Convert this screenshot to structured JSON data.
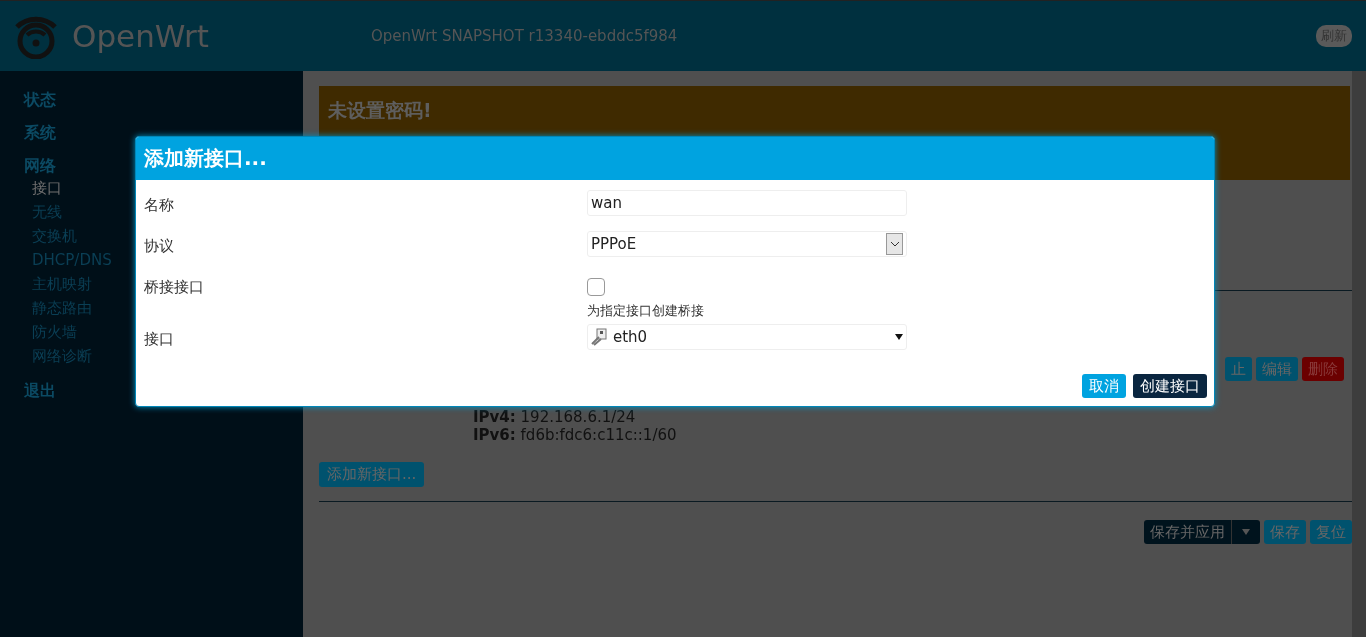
{
  "header": {
    "brand": "OpenWrt",
    "version": "OpenWrt SNAPSHOT r13340-ebddc5f984",
    "refresh_button": "刷新"
  },
  "sidebar": {
    "items": [
      {
        "label": "状态"
      },
      {
        "label": "系统"
      },
      {
        "label": "网络",
        "children": [
          {
            "label": "接口",
            "selected": true
          },
          {
            "label": "无线",
            "selected": false
          },
          {
            "label": "交换机",
            "selected": false
          },
          {
            "label": "DHCP/DNS",
            "selected": false
          },
          {
            "label": "主机映射",
            "selected": false
          },
          {
            "label": "静态路由",
            "selected": false
          },
          {
            "label": "防火墙",
            "selected": false
          },
          {
            "label": "网络诊断",
            "selected": false
          }
        ]
      },
      {
        "label": "退出"
      }
    ]
  },
  "warning": {
    "title": "未设置密码!"
  },
  "interface_row": {
    "buttons": [
      {
        "label": "止",
        "kind": "normal"
      },
      {
        "label": "编辑",
        "kind": "normal"
      },
      {
        "label": "删除",
        "kind": "danger"
      }
    ],
    "addresses": [
      {
        "label": "IPv4:",
        "value": "192.168.6.1/24"
      },
      {
        "label": "IPv6:",
        "value": "fd6b:fdc6:c11c::1/60"
      }
    ]
  },
  "add_button": "添加新接口...",
  "footer_buttons": [
    {
      "label": "保存并应用",
      "kind": "split"
    },
    {
      "label": "保存",
      "kind": "normal"
    },
    {
      "label": "复位",
      "kind": "normal"
    }
  ],
  "dialog": {
    "title": "添加新接口...",
    "fields": [
      {
        "kind": "text",
        "label": "名称",
        "value": "wan"
      },
      {
        "kind": "select",
        "label": "协议",
        "value": "PPPoE"
      },
      {
        "kind": "checkbox",
        "label": "桥接接口",
        "checked": false,
        "hint": "为指定接口创建桥接"
      },
      {
        "kind": "device",
        "label": "接口",
        "value": "eth0"
      }
    ],
    "buttons": [
      {
        "label": "取消",
        "kind": "secondary"
      },
      {
        "label": "创建接口",
        "kind": "primary"
      }
    ]
  }
}
